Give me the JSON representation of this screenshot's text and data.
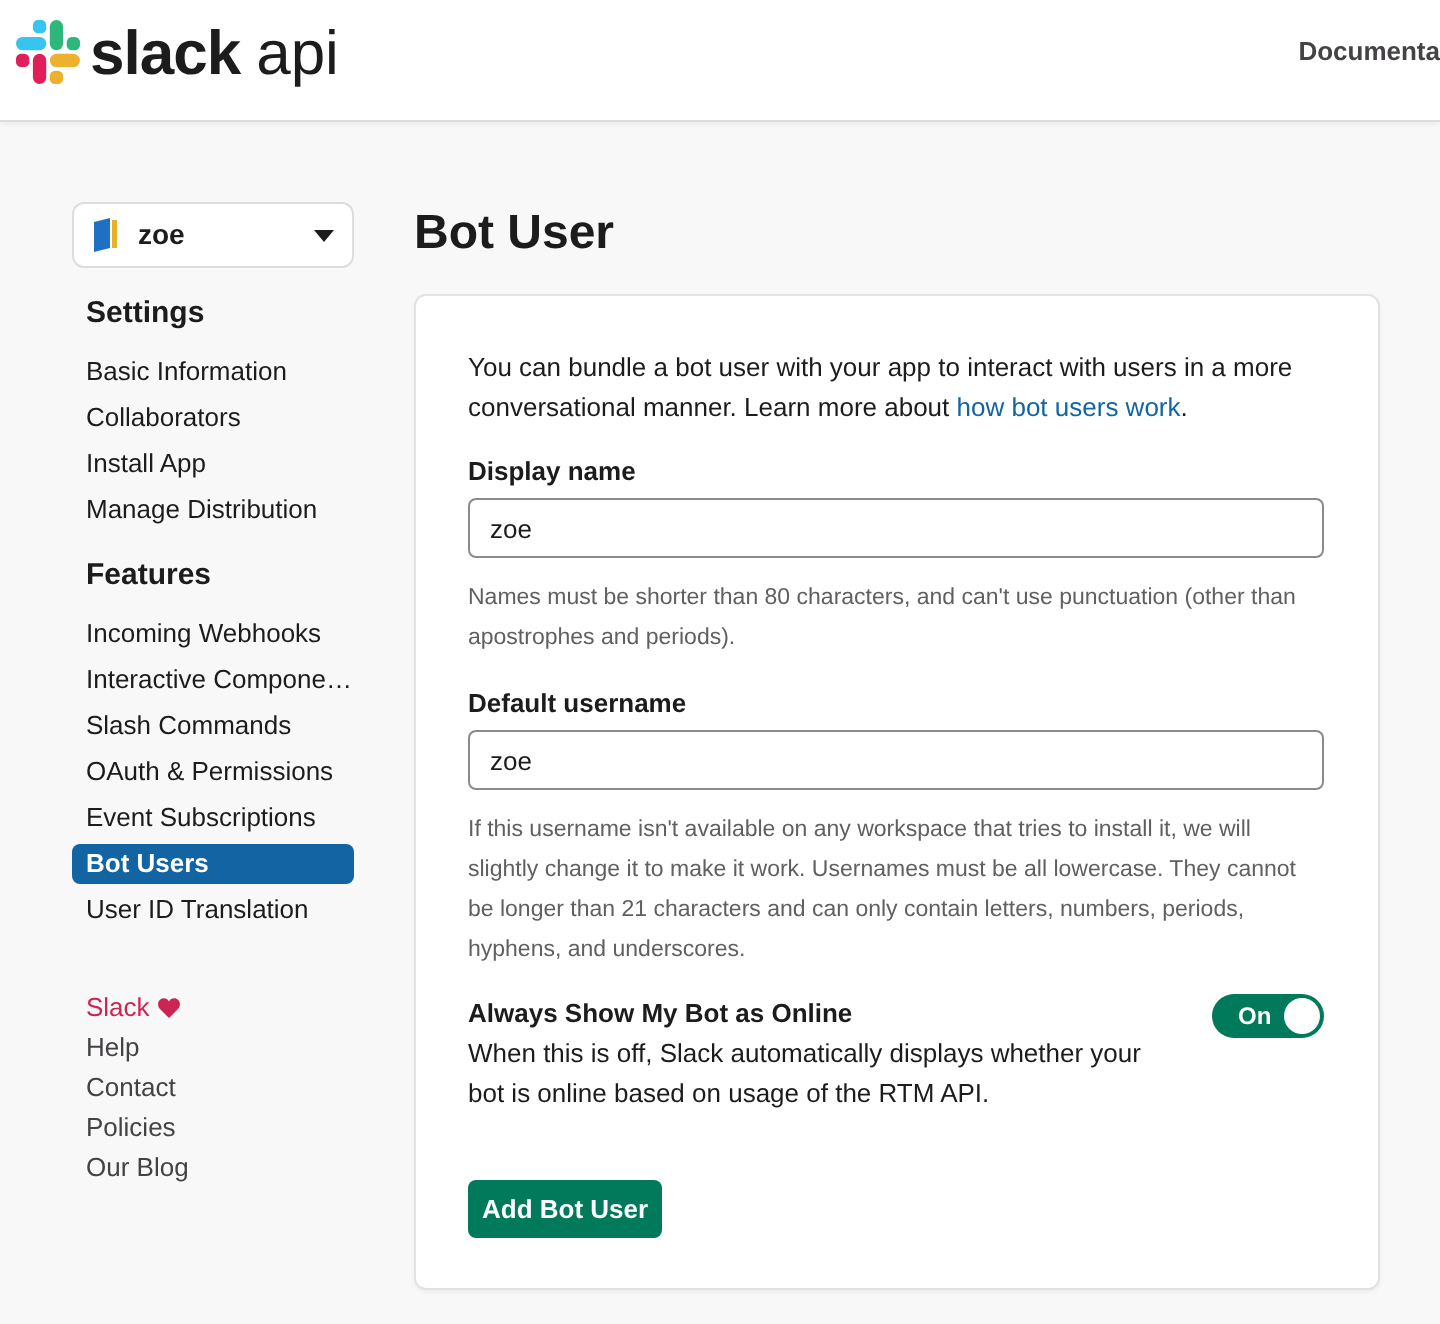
{
  "header": {
    "logo_text": "slack",
    "logo_suffix": "api",
    "nav": [
      {
        "label": "Documenta"
      }
    ]
  },
  "sidebar": {
    "app_selector": {
      "value": "zoe"
    },
    "sections": [
      {
        "heading": "Settings",
        "items": [
          {
            "label": "Basic Information",
            "selected": false
          },
          {
            "label": "Collaborators",
            "selected": false
          },
          {
            "label": "Install App",
            "selected": false
          },
          {
            "label": "Manage Distribution",
            "selected": false
          }
        ]
      },
      {
        "heading": "Features",
        "items": [
          {
            "label": "Incoming Webhooks",
            "selected": false
          },
          {
            "label": "Interactive Compone…",
            "selected": false
          },
          {
            "label": "Slash Commands",
            "selected": false
          },
          {
            "label": "OAuth & Permissions",
            "selected": false
          },
          {
            "label": "Event Subscriptions",
            "selected": false
          },
          {
            "label": "Bot Users",
            "selected": true
          },
          {
            "label": "User ID Translation",
            "selected": false
          }
        ]
      }
    ],
    "footer_links": [
      {
        "label": "Slack",
        "kind": "brand"
      },
      {
        "label": "Help",
        "kind": "link"
      },
      {
        "label": "Contact",
        "kind": "link"
      },
      {
        "label": "Policies",
        "kind": "link"
      },
      {
        "label": "Our Blog",
        "kind": "link"
      }
    ]
  },
  "page": {
    "title": "Bot User",
    "intro": {
      "text": "You can bundle a bot user with your app to interact with users in a more conversational manner. Learn more about",
      "link": "how bot users work",
      "after": "."
    },
    "fields": [
      {
        "label": "Display name",
        "value": "zoe",
        "hint": "Names must be shorter than 80 characters, and can't use punctuation (other than apostrophes and periods)."
      },
      {
        "label": "Default username",
        "value": "zoe",
        "hint": "If this username isn't available on any workspace that tries to install it, we will slightly change it to make it work. Usernames must be all lowercase. They cannot be longer than 21 characters and can only contain letters, numbers, periods, hyphens, and underscores."
      }
    ],
    "toggle": {
      "label": "Always Show My Bot as Online",
      "description": "When this is off, Slack automatically displays whether your bot is online based on usage of the RTM API.",
      "on": true,
      "state_text": "On"
    },
    "button": {
      "label": "Add Bot User"
    }
  }
}
